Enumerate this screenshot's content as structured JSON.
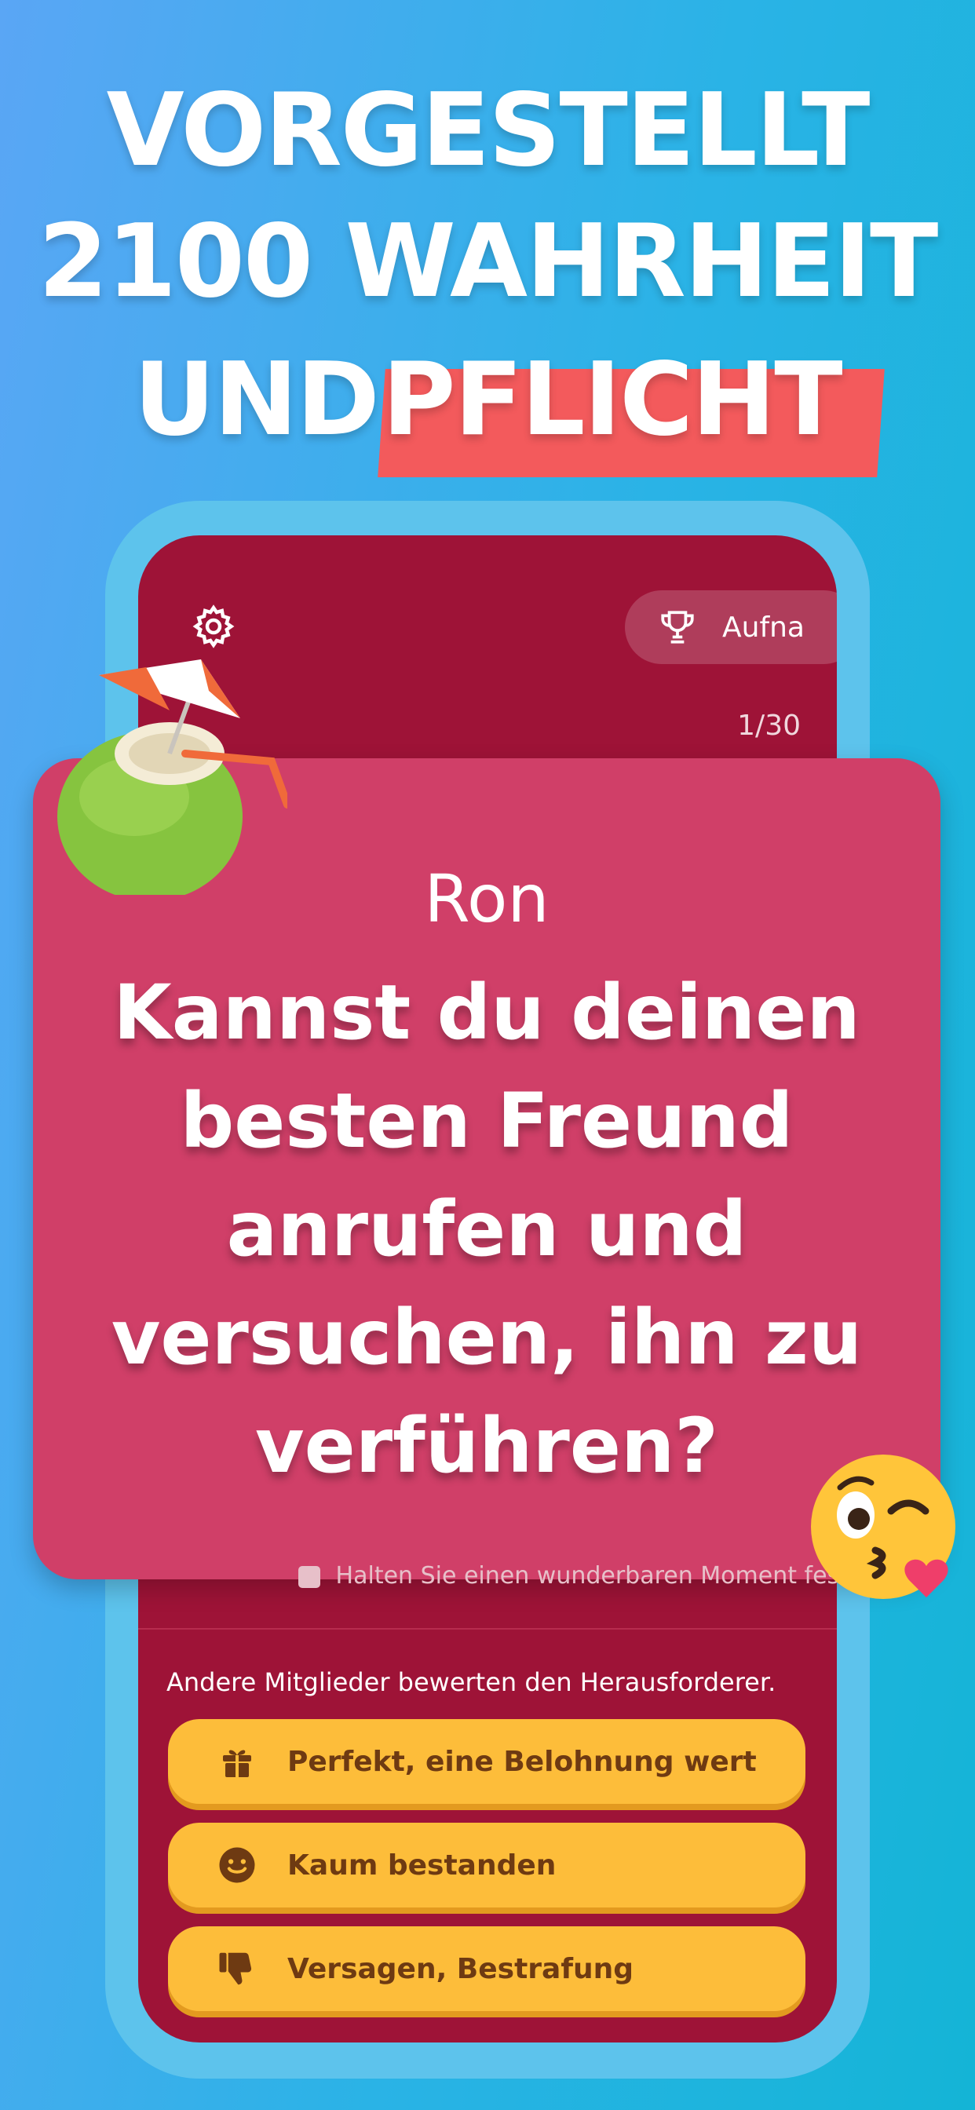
{
  "headline": {
    "line1": "VORGESTELLT",
    "line2": "2100 WAHRHEIT",
    "line3_a": "UND",
    "line3_b": "PFLICHT"
  },
  "app": {
    "record_label": "Aufna",
    "counter": "1/30",
    "card": {
      "player": "Ron",
      "question": "Kannst du deinen besten Freund anrufen und versuchen, ihn zu verführen?"
    },
    "hint_text": "Halten Sie einen wunderbaren Moment fes",
    "rating_prompt": "Andere Mitglieder bewerten den Herausforderer.",
    "buttons": [
      {
        "label": "Perfekt, eine Belohnung wert",
        "icon": "gift-icon"
      },
      {
        "label": "Kaum bestanden",
        "icon": "smile-icon"
      },
      {
        "label": "Versagen, Bestrafung",
        "icon": "thumbs-down-icon"
      }
    ]
  },
  "colors": {
    "background_start": "#5aa6f5",
    "background_end": "#14b4d6",
    "screen": "#9e1337",
    "card": "#d03f68",
    "highlight": "#f35a5c",
    "button": "#fdbd3a"
  }
}
